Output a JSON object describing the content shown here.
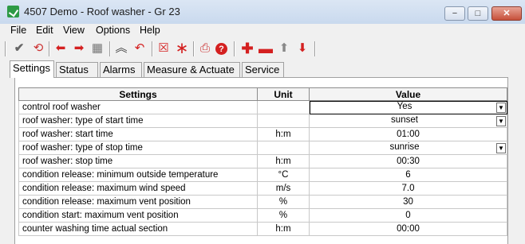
{
  "window": {
    "title": "4507 Demo - Roof washer - Gr 23",
    "minimize_label": "−",
    "restore_label": "□",
    "close_label": "✕"
  },
  "menu": [
    "File",
    "Edit",
    "View",
    "Options",
    "Help"
  ],
  "toolbar": {
    "icons": [
      "check-icon",
      "refresh-icon",
      "arrow-left-icon",
      "arrow-right-icon",
      "table-icon",
      "collapse-icon",
      "undo-icon",
      "delete-box-icon",
      "asterisk-icon",
      "print-icon",
      "help-icon",
      "add-icon",
      "remove-icon",
      "move-up-icon",
      "move-down-icon"
    ]
  },
  "tabs": [
    "Settings",
    "Status",
    "Alarms",
    "Measure & Actuate",
    "Service"
  ],
  "active_tab": "Settings",
  "grid": {
    "headers": [
      "Settings",
      "Unit",
      "Value"
    ],
    "rows": [
      {
        "setting": "control roof washer",
        "unit": "",
        "value": "Yes",
        "dropdown": true
      },
      {
        "setting": "roof washer: type of start time",
        "unit": "",
        "value": "sunset",
        "dropdown": true
      },
      {
        "setting": "roof washer: start time",
        "unit": "h:m",
        "value": "01:00",
        "dropdown": false
      },
      {
        "setting": "roof washer: type of stop time",
        "unit": "",
        "value": "sunrise",
        "dropdown": true
      },
      {
        "setting": "roof washer: stop time",
        "unit": "h:m",
        "value": "00:30",
        "dropdown": false
      },
      {
        "setting": "condition release: minimum outside temperature",
        "unit": "°C",
        "value": "6",
        "dropdown": false
      },
      {
        "setting": "condition release: maximum wind speed",
        "unit": "m/s",
        "value": "7.0",
        "dropdown": false
      },
      {
        "setting": "condition release: maximum vent position",
        "unit": "%",
        "value": "30",
        "dropdown": false
      },
      {
        "setting": "condition start: maximum vent position",
        "unit": "%",
        "value": "0",
        "dropdown": false
      },
      {
        "setting": "counter washing time actual section",
        "unit": "h:m",
        "value": "00:00",
        "dropdown": false
      }
    ]
  },
  "colors": {
    "accent_red": "#d42020",
    "title_bg": "#dbe6f4",
    "app_icon": "#2d9a45"
  }
}
